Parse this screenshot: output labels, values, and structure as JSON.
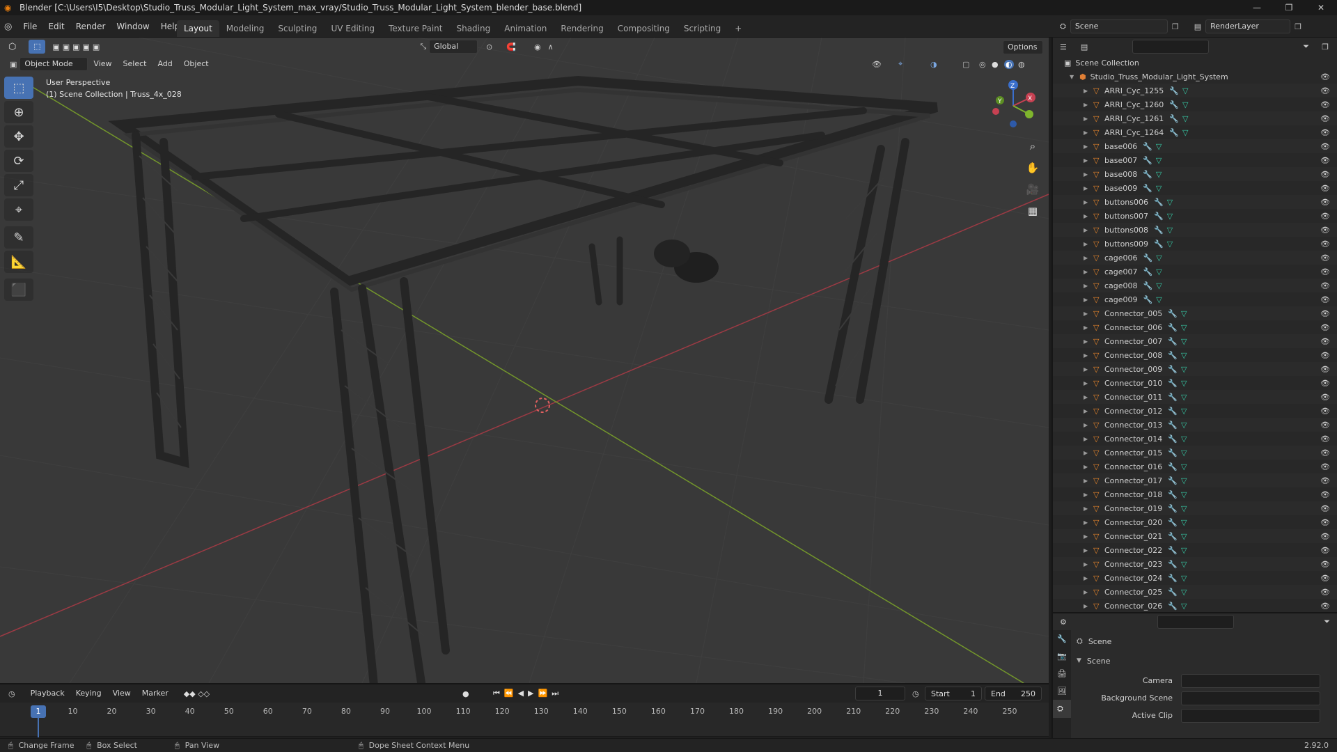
{
  "title_bar": {
    "title": "Blender [C:\\Users\\I5\\Desktop\\Studio_Truss_Modular_Light_System_max_vray/Studio_Truss_Modular_Light_System_blender_base.blend]",
    "controls": [
      "—",
      "❐",
      "✕"
    ]
  },
  "menu": [
    "File",
    "Edit",
    "Render",
    "Window",
    "Help"
  ],
  "workspaces": [
    "Layout",
    "Modeling",
    "Sculpting",
    "UV Editing",
    "Texture Paint",
    "Shading",
    "Animation",
    "Rendering",
    "Compositing",
    "Scripting"
  ],
  "active_workspace": "Layout",
  "add_workspace": "+",
  "scene_selector": "Scene",
  "render_layer": "RenderLayer",
  "viewport": {
    "transform_orientation": "Global",
    "options_label": "Options",
    "mode": "Object Mode",
    "menus": [
      "View",
      "Select",
      "Add",
      "Object"
    ],
    "info_line1": "User Perspective",
    "info_line2": "(1) Scene Collection | Truss_4x_028",
    "gizmo": {
      "x": "X",
      "y": "Y",
      "z": "Z"
    },
    "colors": {
      "x_axis": "#b8424d",
      "y_axis": "#8ab335",
      "background": "#393939",
      "truss": "#2a2a2a"
    }
  },
  "tools": [
    {
      "name": "select-box-tool",
      "glyph": "⬚",
      "active": true
    },
    {
      "name": "cursor-tool",
      "glyph": "⊕",
      "active": false
    },
    {
      "name": "move-tool",
      "glyph": "✥",
      "active": false
    },
    {
      "name": "rotate-tool",
      "glyph": "⟳",
      "active": false
    },
    {
      "name": "scale-tool",
      "glyph": "⤢",
      "active": false
    },
    {
      "name": "transform-tool",
      "glyph": "⌖",
      "active": false
    },
    {
      "name": "annotate-tool",
      "glyph": "✎",
      "active": false
    },
    {
      "name": "measure-tool",
      "glyph": "📐",
      "active": false
    },
    {
      "name": "add-cube-tool",
      "glyph": "⬛",
      "active": false
    }
  ],
  "outliner": {
    "root": "Scene Collection",
    "collection": "Studio_Truss_Modular_Light_System",
    "items": [
      "ARRI_Cyc_1255",
      "ARRI_Cyc_1260",
      "ARRI_Cyc_1261",
      "ARRI_Cyc_1264",
      "base006",
      "base007",
      "base008",
      "base009",
      "buttons006",
      "buttons007",
      "buttons008",
      "buttons009",
      "cage006",
      "cage007",
      "cage008",
      "cage009",
      "Connector_005",
      "Connector_006",
      "Connector_007",
      "Connector_008",
      "Connector_009",
      "Connector_010",
      "Connector_011",
      "Connector_012",
      "Connector_013",
      "Connector_014",
      "Connector_015",
      "Connector_016",
      "Connector_017",
      "Connector_018",
      "Connector_019",
      "Connector_020",
      "Connector_021",
      "Connector_022",
      "Connector_023",
      "Connector_024",
      "Connector_025",
      "Connector_026"
    ]
  },
  "properties": {
    "context": "Scene",
    "panel": "Scene",
    "fields": [
      {
        "label": "Camera",
        "value": ""
      },
      {
        "label": "Background Scene",
        "value": ""
      },
      {
        "label": "Active Clip",
        "value": ""
      }
    ]
  },
  "timeline": {
    "menus": [
      "Playback",
      "Keying",
      "View",
      "Marker"
    ],
    "current_frame": "1",
    "start_label": "Start",
    "start": "1",
    "end_label": "End",
    "end": "250",
    "ticks": [
      "10",
      "20",
      "30",
      "40",
      "50",
      "60",
      "70",
      "80",
      "90",
      "100",
      "110",
      "120",
      "130",
      "140",
      "150",
      "160",
      "170",
      "180",
      "190",
      "200",
      "210",
      "220",
      "230",
      "240",
      "250"
    ],
    "playhead": "1"
  },
  "status": {
    "items": [
      "Change Frame",
      "Box Select",
      "Pan View",
      "Dope Sheet Context Menu"
    ],
    "version": "2.92.0"
  }
}
